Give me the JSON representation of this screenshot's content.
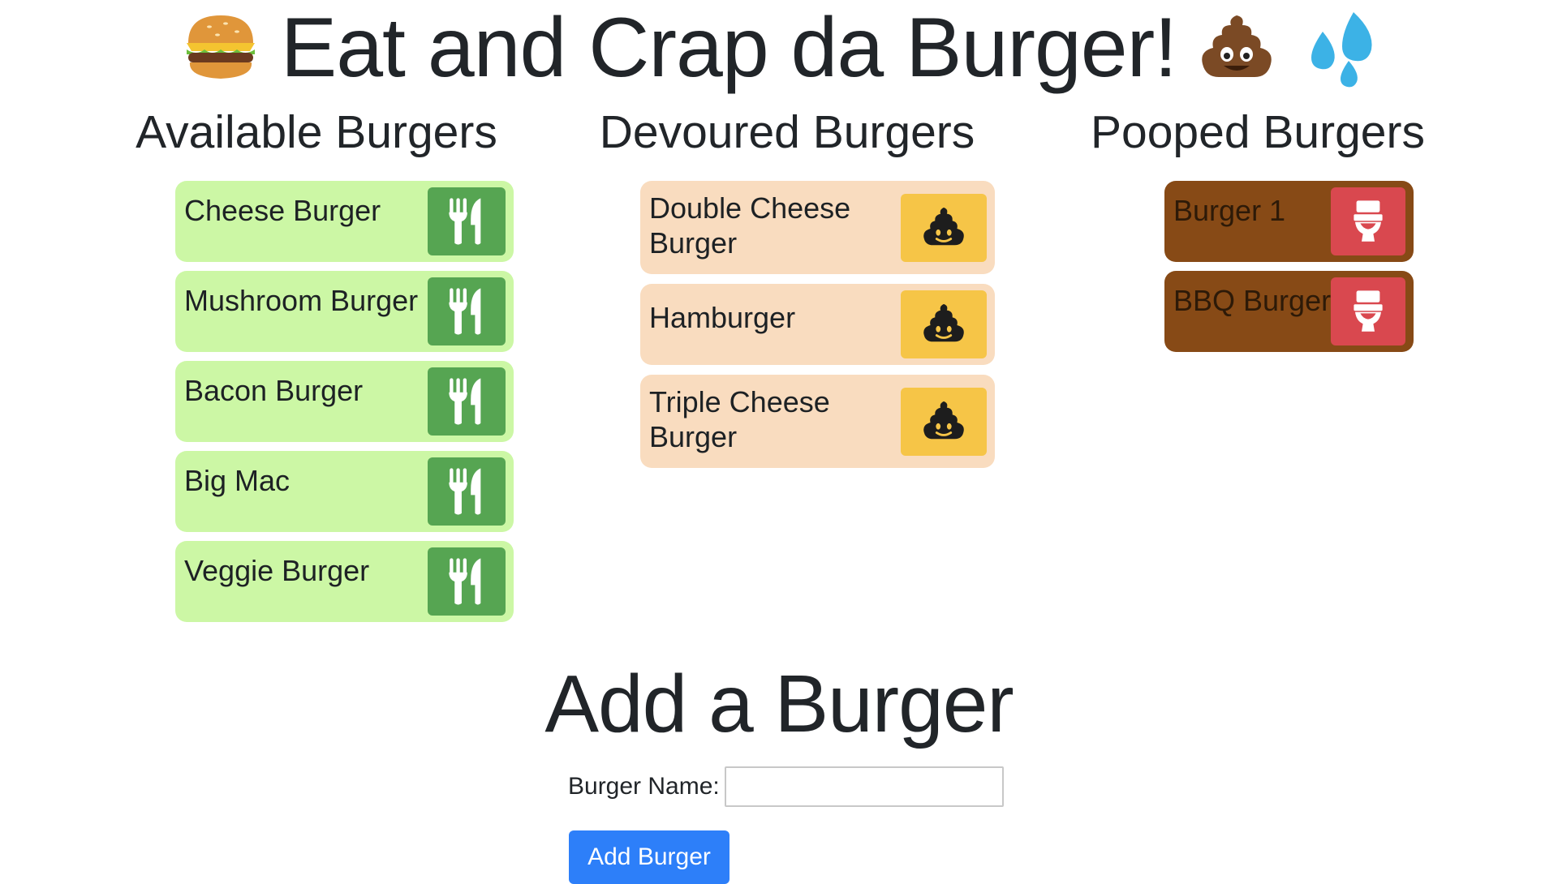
{
  "header": {
    "title": "Eat and Crap da Burger!",
    "left_icon": "hamburger-emoji",
    "right_icons": [
      "pile-of-poo-emoji",
      "sweat-droplets-emoji"
    ]
  },
  "columns": {
    "available": {
      "heading": "Available Burgers",
      "action_icon": "utensils-icon",
      "items": [
        {
          "label": "Cheese Burger"
        },
        {
          "label": "Mushroom Burger"
        },
        {
          "label": "Bacon Burger"
        },
        {
          "label": "Big Mac"
        },
        {
          "label": "Veggie Burger"
        }
      ]
    },
    "devoured": {
      "heading": "Devoured Burgers",
      "action_icon": "poop-icon",
      "items": [
        {
          "label_line1": "Double Cheese",
          "label_line2": "Burger"
        },
        {
          "label_line1": "Hamburger",
          "label_line2": ""
        },
        {
          "label_line1": "Triple Cheese",
          "label_line2": "Burger"
        }
      ]
    },
    "pooped": {
      "heading": "Pooped Burgers",
      "action_icon": "toilet-icon",
      "items": [
        {
          "label": "Burger 1"
        },
        {
          "label": "BBQ Burger"
        }
      ]
    }
  },
  "form": {
    "heading": "Add a Burger",
    "name_label": "Burger Name:",
    "name_value": "",
    "submit_label": "Add Burger"
  },
  "colors": {
    "available_bg": "#ccf7a5",
    "available_button": "#56a552",
    "devoured_bg": "#f9dcbf",
    "devoured_button": "#f6c547",
    "pooped_bg": "#874a16",
    "pooped_button": "#d9484f",
    "submit_button": "#2d7ff9"
  }
}
